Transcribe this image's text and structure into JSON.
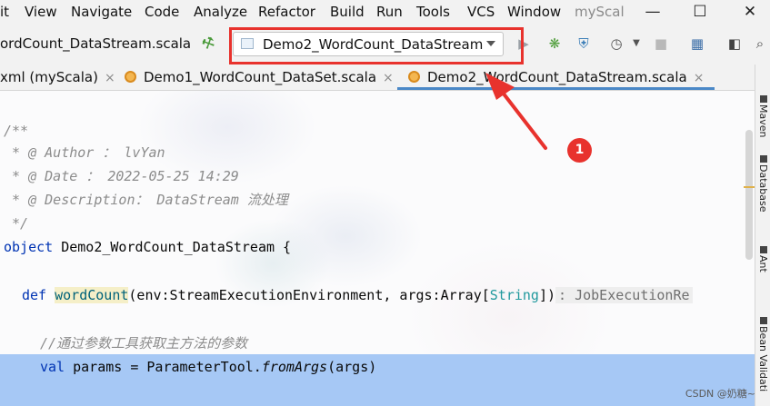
{
  "menu": {
    "items": [
      "it",
      "View",
      "Navigate",
      "Code",
      "Analyze",
      "Refactor",
      "Build",
      "Run",
      "Tools",
      "VCS",
      "Window"
    ],
    "project_title": "myScal",
    "minimize": "—",
    "maximize": "☐",
    "close": "✕"
  },
  "toolbar": {
    "breadcrumb": "ordCount_DataStream.scala",
    "run_config": "Demo2_WordCount_DataStream"
  },
  "tabs": [
    {
      "label": "xml (myScala)",
      "close": "×"
    },
    {
      "label": "Demo1_WordCount_DataSet.scala",
      "close": "×"
    },
    {
      "label": "Demo2_WordCount_DataStream.scala",
      "close": "×"
    }
  ],
  "editor": {
    "lines": {
      "doc_open": "/**",
      "author": " * @ Author ： lvYan",
      "date": " * @ Date ： 2022-05-25 14:29",
      "desc": " * @ Description： DataStream 流处理",
      "doc_close": " */",
      "kw_object": "object",
      "object_name": " Demo2_WordCount_DataStream {",
      "kw_def": "def",
      "def_name": "wordCount",
      "def_params_a": "(env:StreamExecutionEnvironment, args:Array[",
      "def_type": "String",
      "def_params_b": "])",
      "return_hint": ": JobExecutionRe",
      "comment": "//通过参数工具获取主方法的参数",
      "kw_val": "val",
      "val_lhs": " params = ParameterTool.",
      "val_method": "fromArgs",
      "val_args": "(args)"
    }
  },
  "annotation": {
    "badge": "1",
    "highlight_color": "#e8322d"
  },
  "side_panel": {
    "labels": [
      "Maven",
      "Database",
      "Ant",
      "Bean Validati"
    ]
  },
  "watermark": "CSDN @奶糖~"
}
